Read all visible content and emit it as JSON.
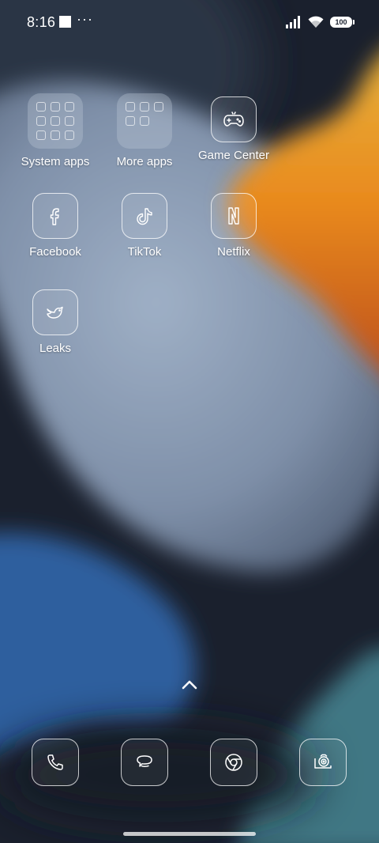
{
  "status_bar": {
    "time": "8:16",
    "more_indicator": "···",
    "battery_level": "100",
    "icons": [
      "notification-square-icon",
      "signal-icon",
      "wifi-icon",
      "battery-icon"
    ]
  },
  "home": {
    "apps": [
      {
        "label": "System apps",
        "icon": "folder-icon"
      },
      {
        "label": "More apps",
        "icon": "folder-icon"
      },
      {
        "label": "Game Center",
        "icon": "gamepad-icon"
      },
      {
        "label": "Facebook",
        "icon": "facebook-icon"
      },
      {
        "label": "TikTok",
        "icon": "tiktok-icon"
      },
      {
        "label": "Netflix",
        "icon": "netflix-icon"
      },
      {
        "label": "Leaks",
        "icon": "bird-icon"
      }
    ],
    "swipe_up_icon": "chevron-up-icon"
  },
  "dock": {
    "apps": [
      {
        "icon": "phone-icon"
      },
      {
        "icon": "messages-icon"
      },
      {
        "icon": "chrome-icon"
      },
      {
        "icon": "camera-icon"
      }
    ]
  },
  "colors": {
    "wallpaper_base": "#1b2230",
    "wallpaper_light": "#8fa2bd",
    "wallpaper_orange": "#e98a1e",
    "wallpaper_yellow": "#e6b23b",
    "wallpaper_blue": "#2e5f9e",
    "wallpaper_teal": "#3f7784"
  }
}
